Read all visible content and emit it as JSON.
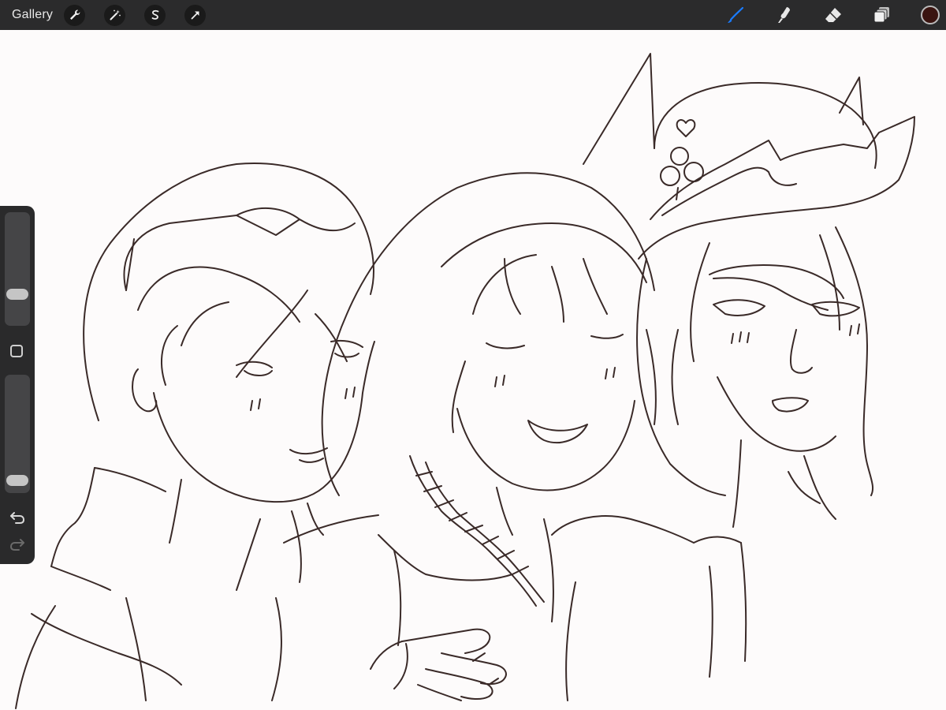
{
  "topbar": {
    "gallery_label": "Gallery",
    "left_tools": [
      {
        "name": "actions",
        "icon": "wrench-icon"
      },
      {
        "name": "adjustments",
        "icon": "magic-wand-icon"
      },
      {
        "name": "selection",
        "icon": "selection-s-icon"
      },
      {
        "name": "transform",
        "icon": "arrow-cursor-icon"
      }
    ],
    "right_tools": [
      {
        "name": "brush",
        "icon": "brush-icon",
        "active": true
      },
      {
        "name": "smudge",
        "icon": "smudge-icon"
      },
      {
        "name": "eraser",
        "icon": "eraser-icon"
      },
      {
        "name": "layers",
        "icon": "layers-icon"
      }
    ],
    "current_color": "#3a1410",
    "accent_color": "#1a7cff"
  },
  "sidebar": {
    "brush_size_level": 0.25,
    "opacity_level": 0.05
  }
}
